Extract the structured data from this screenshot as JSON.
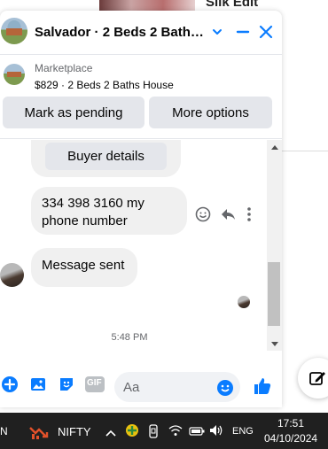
{
  "background": {
    "partial_text": "Silk Edit"
  },
  "chat": {
    "title": "Salvador · 2 Beds 2 Baths ...",
    "listing": {
      "category": "Marketplace",
      "description": "$829 · 2 Beds 2 Baths House"
    },
    "actions": {
      "mark_pending": "Mark as pending",
      "more_options": "More options"
    },
    "messages": {
      "buyer_details": "Buyer details",
      "phone_line1": "334 398 3160 my",
      "phone_line2": "phone number",
      "sent": "Message sent",
      "timestamp": "5:48 PM"
    },
    "composer": {
      "placeholder": "Aa",
      "gif_label": "GIF"
    }
  },
  "taskbar": {
    "widget_label": "NIFTY",
    "left_partial": "N",
    "language": "ENG",
    "time": "17:51",
    "date": "04/10/2024"
  },
  "colors": {
    "accent": "#0a7cff",
    "taskbar_bg": "#202020",
    "bubble_bg": "#f0f0f0"
  }
}
